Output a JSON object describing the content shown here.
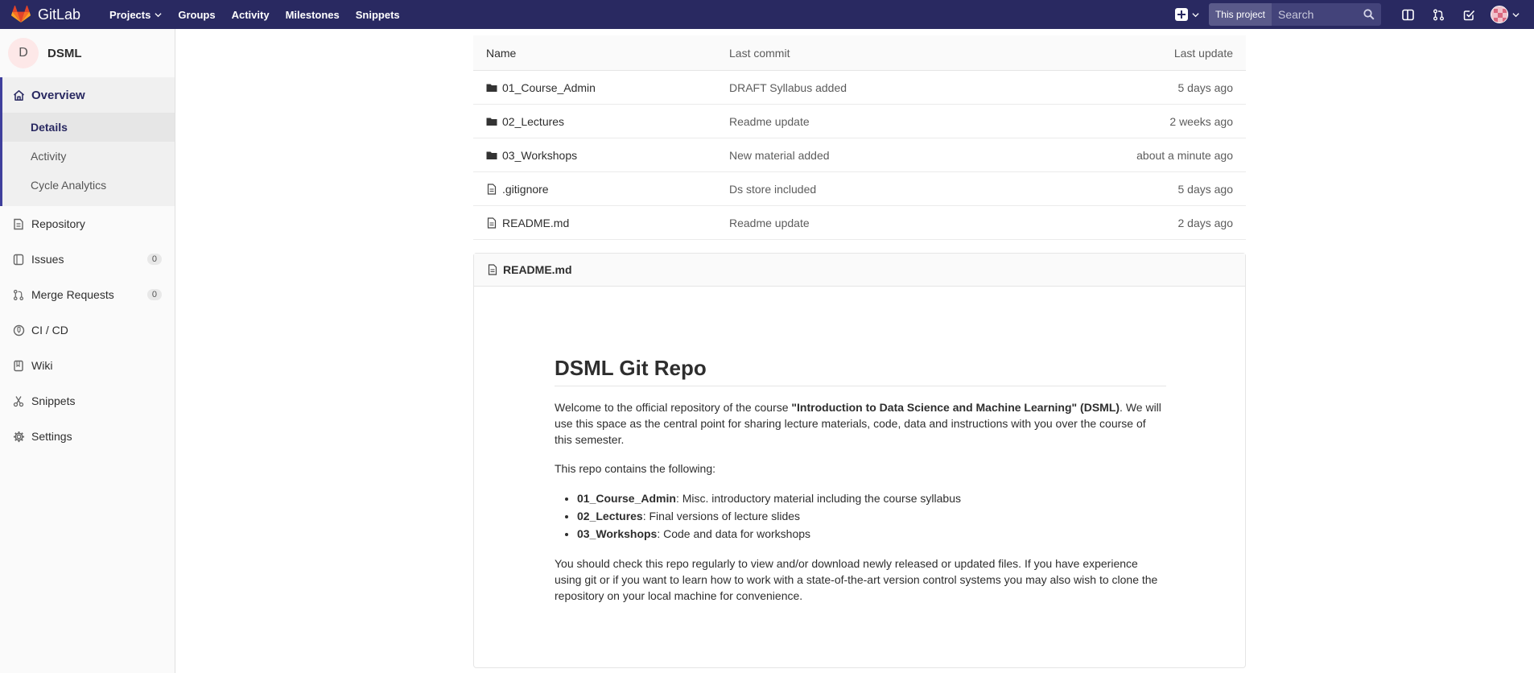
{
  "topbar": {
    "brand": "GitLab",
    "nav": [
      {
        "label": "Projects",
        "dropdown": true
      },
      {
        "label": "Groups"
      },
      {
        "label": "Activity"
      },
      {
        "label": "Milestones"
      },
      {
        "label": "Snippets"
      }
    ],
    "search_scope": "This project",
    "search_placeholder": "Search"
  },
  "sidebar": {
    "project_initial": "D",
    "project_name": "DSML",
    "overview": "Overview",
    "sub_items": [
      "Details",
      "Activity",
      "Cycle Analytics"
    ],
    "items": [
      {
        "label": "Repository",
        "icon": "document-icon"
      },
      {
        "label": "Issues",
        "icon": "issues-icon",
        "count": "0"
      },
      {
        "label": "Merge Requests",
        "icon": "merge-request-icon",
        "count": "0"
      },
      {
        "label": "CI / CD",
        "icon": "rocket-icon"
      },
      {
        "label": "Wiki",
        "icon": "book-icon"
      },
      {
        "label": "Snippets",
        "icon": "scissors-icon"
      },
      {
        "label": "Settings",
        "icon": "gear-icon"
      }
    ]
  },
  "tree": {
    "headers": [
      "Name",
      "Last commit",
      "Last update"
    ],
    "rows": [
      {
        "name": "01_Course_Admin",
        "type": "folder",
        "commit": "DRAFT Syllabus added",
        "updated": "5 days ago"
      },
      {
        "name": "02_Lectures",
        "type": "folder",
        "commit": "Readme update",
        "updated": "2 weeks ago"
      },
      {
        "name": "03_Workshops",
        "type": "folder",
        "commit": "New material added",
        "updated": "about a minute ago"
      },
      {
        "name": ".gitignore",
        "type": "file",
        "commit": "Ds store included",
        "updated": "5 days ago"
      },
      {
        "name": "README.md",
        "type": "file",
        "commit": "Readme update",
        "updated": "2 days ago"
      }
    ]
  },
  "readme": {
    "filename": "README.md",
    "title": "DSML Git Repo",
    "intro_pre": "Welcome to the official repository of the course ",
    "intro_bold": "\"Introduction to Data Science and Machine Learning\" (DSML)",
    "intro_post": ". We will use this space as the central point for sharing lecture materials, code, data and instructions with you over the course of this semester.",
    "contains": "This repo contains the following:",
    "list": [
      {
        "bold": "01_Course_Admin",
        "text": ": Misc. introductory material including the course syllabus"
      },
      {
        "bold": "02_Lectures",
        "text": ": Final versions of lecture slides"
      },
      {
        "bold": "03_Workshops",
        "text": ": Code and data for workshops"
      }
    ],
    "closing": "You should check this repo regularly to view and/or download newly released or updated files. If you have experience using git or if you want to learn how to work with a state-of-the-art version control systems you may also wish to clone the repository on your local machine for convenience."
  },
  "colors": {
    "navbar": "#292961",
    "accent": "#3f3f9c"
  }
}
